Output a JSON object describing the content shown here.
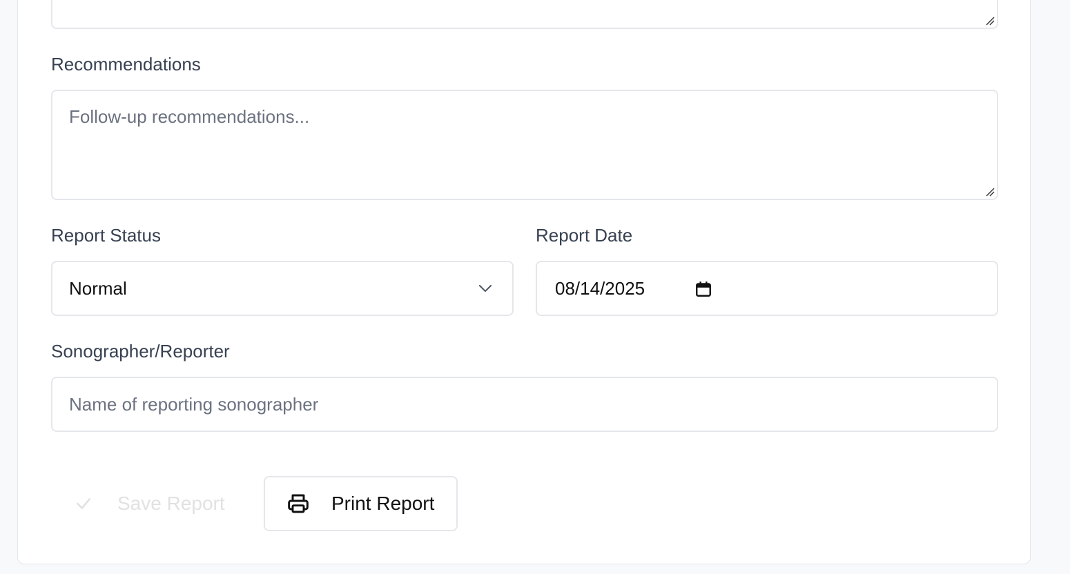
{
  "form": {
    "recommendations": {
      "label": "Recommendations",
      "placeholder": "Follow-up recommendations..."
    },
    "report_status": {
      "label": "Report Status",
      "selected": "Normal"
    },
    "report_date": {
      "label": "Report Date",
      "value": "08/14/2025"
    },
    "sonographer": {
      "label": "Sonographer/Reporter",
      "placeholder": "Name of reporting sonographer"
    }
  },
  "actions": {
    "save_label": "Save Report",
    "print_label": "Print Report"
  },
  "icons": {
    "save": "check-icon",
    "print": "printer-icon",
    "select": "chevron-down-icon",
    "date": "calendar-icon"
  }
}
